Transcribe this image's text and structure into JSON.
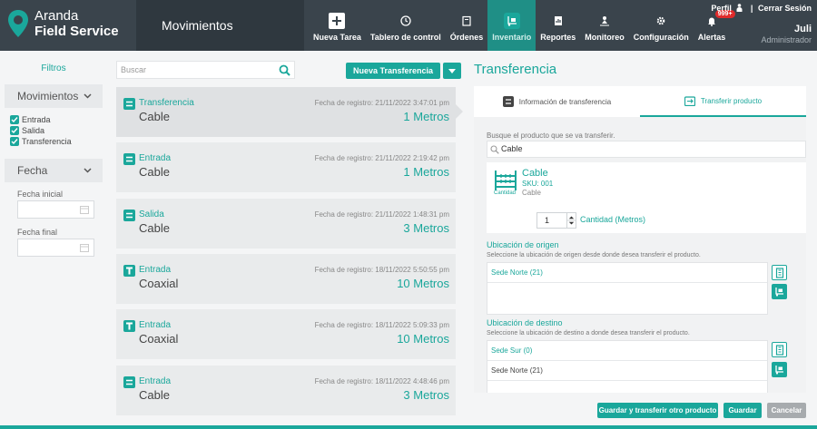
{
  "app": {
    "logo_line1": "Aranda",
    "logo_line2": "Field Service",
    "section_title": "Movimientos"
  },
  "nav": [
    {
      "label": "Nueva Tarea",
      "icon": "plus-icon"
    },
    {
      "label": "Tablero de control",
      "icon": "clock-icon"
    },
    {
      "label": "Órdenes",
      "icon": "clipboard-icon"
    },
    {
      "label": "Inventario",
      "icon": "dolly-icon",
      "active": true
    },
    {
      "label": "Reportes",
      "icon": "report-icon"
    },
    {
      "label": "Monitoreo",
      "icon": "person-pin-icon"
    },
    {
      "label": "Configuración",
      "icon": "gear-icon"
    },
    {
      "label": "Alertas",
      "icon": "bell-icon",
      "badge": "999+"
    }
  ],
  "user": {
    "perfil": "Perfil",
    "separator": "|",
    "logout": "Cerrar Sesión",
    "name": "Juli",
    "role": "Administrador"
  },
  "filters": {
    "title": "Filtros",
    "movimientos_label": "Movimientos",
    "options": [
      "Entrada",
      "Salida",
      "Transferencia"
    ],
    "fecha_label": "Fecha",
    "fecha_inicial": "Fecha inicial",
    "fecha_final": "Fecha final"
  },
  "list": {
    "search_placeholder": "Buscar",
    "new_button": "Nueva Transferencia",
    "items": [
      {
        "type": "Transferencia",
        "name": "Cable",
        "date": "Fecha de registro: 21/11/2022 3:47:01 pm",
        "qty": "1 Metros"
      },
      {
        "type": "Entrada",
        "name": "Cable",
        "date": "Fecha de registro: 21/11/2022 2:19:42 pm",
        "qty": "1 Metros"
      },
      {
        "type": "Salida",
        "name": "Cable",
        "date": "Fecha de registro: 21/11/2022 1:48:31 pm",
        "qty": "3 Metros"
      },
      {
        "type": "Entrada",
        "name": "Coaxial",
        "date": "Fecha de registro: 18/11/2022 5:50:55 pm",
        "qty": "10 Metros"
      },
      {
        "type": "Entrada",
        "name": "Coaxial",
        "date": "Fecha de registro: 18/11/2022 5:09:33 pm",
        "qty": "10 Metros"
      },
      {
        "type": "Entrada",
        "name": "Cable",
        "date": "Fecha de registro: 18/11/2022 4:48:46 pm",
        "qty": "3 Metros"
      }
    ]
  },
  "panel": {
    "title": "Transferencia",
    "tab_info": "Información de transferencia",
    "tab_transfer": "Transferir producto",
    "search_hint": "Busque el producto que se va transferir.",
    "search_value": "Cable",
    "product": {
      "name": "Cable",
      "sku": "SKU: 001",
      "desc": "Cable",
      "icon_label": "Cantidad",
      "qty": "1",
      "qty_label": "Cantidad (Metros)"
    },
    "origin": {
      "title": "Ubicación de origen",
      "hint": "Seleccione la ubicación de origen desde donde desea transferir el producto.",
      "rows": [
        "Sede Norte (21)"
      ]
    },
    "dest": {
      "title": "Ubicación de destino",
      "hint": "Seleccione la ubicación de destino a donde desea transferir el producto.",
      "rows": [
        "Sede Sur (0)",
        "Sede Norte (21)"
      ]
    }
  },
  "footer": {
    "save_next": "Guardar y transferir otro producto",
    "save": "Guardar",
    "cancel": "Cancelar"
  },
  "colors": {
    "accent": "#1aa79b",
    "topbar": "#3a444c",
    "badge": "#e02b2b"
  }
}
